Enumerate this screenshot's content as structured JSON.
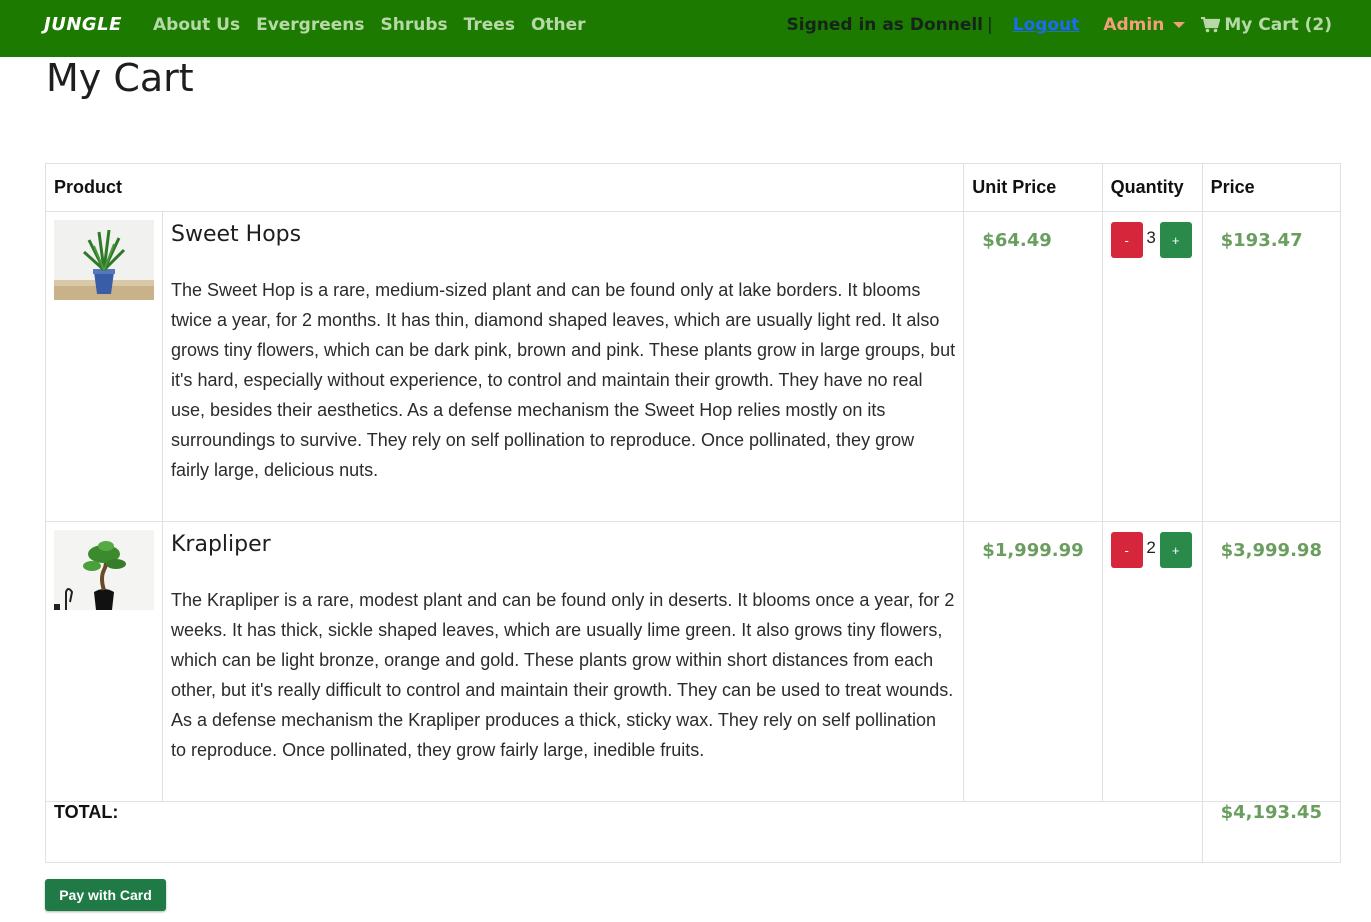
{
  "nav": {
    "brand": "JUNGLE",
    "links": [
      "About Us",
      "Evergreens",
      "Shrubs",
      "Trees",
      "Other"
    ],
    "signed_in": "Signed in as Donnell",
    "separator": "|",
    "logout": "Logout",
    "admin": "Admin",
    "cart": "My Cart (2)"
  },
  "page": {
    "title": "My Cart"
  },
  "table": {
    "headers": {
      "product": "Product",
      "unit_price": "Unit Price",
      "quantity": "Quantity",
      "price": "Price"
    },
    "items": [
      {
        "name": "Sweet Hops",
        "description": "The Sweet Hop is a rare, medium-sized plant and can be found only at lake borders. It blooms twice a year, for 2 months. It has thin, diamond shaped leaves, which are usually light red. It also grows tiny flowers, which can be dark pink, brown and pink. These plants grow in large groups, but it's hard, especially without experience, to control and maintain their growth. They have no real use, besides their aesthetics. As a defense mechanism the Sweet Hop relies mostly on its surroundings to survive. They rely on self pollination to reproduce. Once pollinated, they grow fairly large, delicious nuts.",
        "unit_price": "$64.49",
        "quantity": "3",
        "price": "$193.47",
        "minus": "-",
        "plus": "+"
      },
      {
        "name": "Krapliper",
        "description": "The Krapliper is a rare, modest plant and can be found only in deserts. It blooms once a year, for 2 weeks. It has thick, sickle shaped leaves, which are usually lime green. It also grows tiny flowers, which can be light bronze, orange and gold. These plants grow within short distances from each other, but it's really difficult to control and maintain their growth. They can be used to treat wounds. As a defense mechanism the Krapliper produces a thick, sticky wax. They rely on self pollination to reproduce. Once pollinated, they grow fairly large, inedible fruits.",
        "unit_price": "$1,999.99",
        "quantity": "2",
        "price": "$3,999.98",
        "minus": "-",
        "plus": "+"
      }
    ],
    "total_label": "TOTAL:",
    "total_value": "$4,193.45"
  },
  "pay_button": "Pay with Card",
  "colors": {
    "navbar": "#1d7a00",
    "money": "#6a9e5e",
    "minus_button": "#d6263b",
    "plus_button": "#2a8a4a",
    "pay_button": "#1f7a45"
  }
}
